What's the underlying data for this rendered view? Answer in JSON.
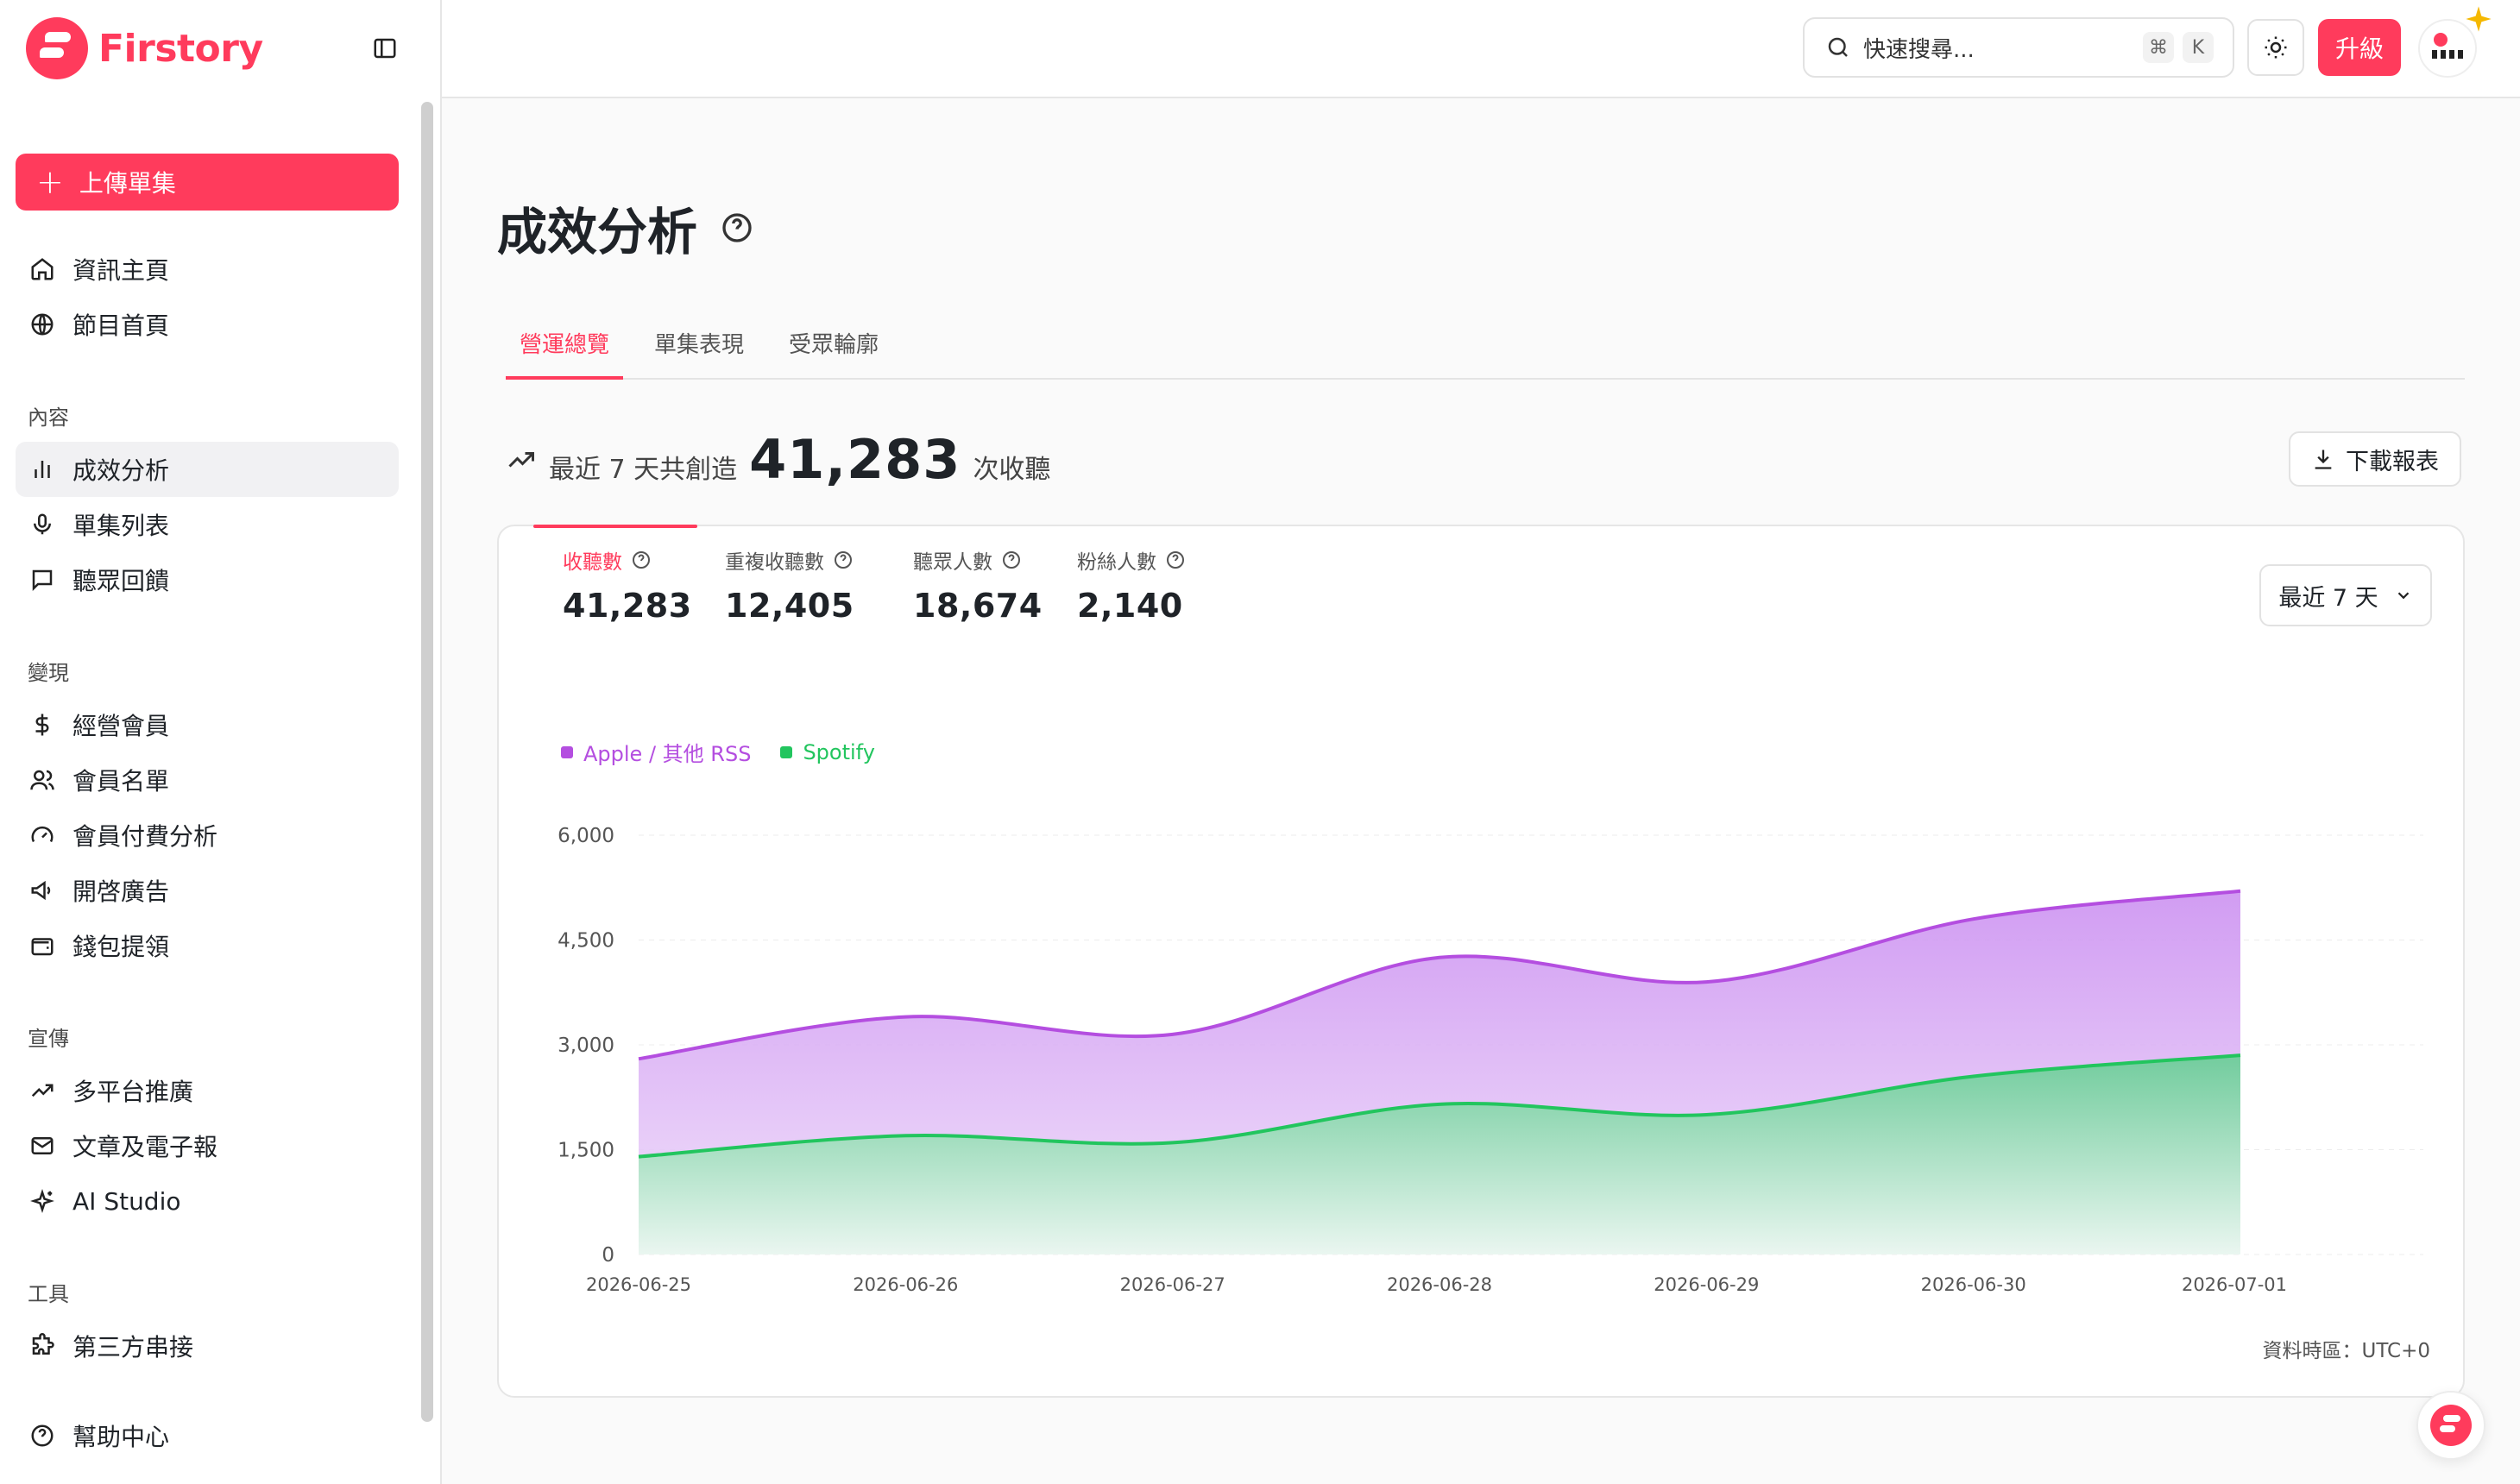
{
  "brand": {
    "name": "Firstory",
    "color": "#ff3b5c"
  },
  "sidebar": {
    "upload_label": "上傳單集",
    "top_items": [
      {
        "label": "資訊主頁",
        "icon": "home-icon"
      },
      {
        "label": "節目首頁",
        "icon": "globe-icon"
      }
    ],
    "sections": [
      {
        "label": "內容",
        "items": [
          {
            "label": "成效分析",
            "icon": "bar-chart-icon",
            "active": true
          },
          {
            "label": "單集列表",
            "icon": "microphone-icon"
          },
          {
            "label": "聽眾回饋",
            "icon": "message-icon"
          }
        ]
      },
      {
        "label": "變現",
        "items": [
          {
            "label": "經營會員",
            "icon": "dollar-icon"
          },
          {
            "label": "會員名單",
            "icon": "users-icon"
          },
          {
            "label": "會員付費分析",
            "icon": "gauge-icon"
          },
          {
            "label": "開啓廣告",
            "icon": "megaphone-icon"
          },
          {
            "label": "錢包提領",
            "icon": "wallet-icon"
          }
        ]
      },
      {
        "label": "宣傳",
        "items": [
          {
            "label": "多平台推廣",
            "icon": "trending-up-icon"
          },
          {
            "label": "文章及電子報",
            "icon": "mail-icon"
          },
          {
            "label": "AI Studio",
            "icon": "sparkles-icon"
          }
        ]
      },
      {
        "label": "工具",
        "items": [
          {
            "label": "第三方串接",
            "icon": "puzzle-icon"
          }
        ]
      }
    ],
    "help_label": "幫助中心"
  },
  "header": {
    "search_placeholder": "快速搜尋...",
    "shortcut_keys": [
      "⌘",
      "K"
    ],
    "upgrade_label": "升級"
  },
  "main": {
    "title": "成效分析",
    "tabs": [
      {
        "label": "營運總覽",
        "active": true
      },
      {
        "label": "單集表現",
        "active": false
      },
      {
        "label": "受眾輪廓",
        "active": false
      }
    ],
    "summary": {
      "prefix": "最近 7 天共創造",
      "value": "41,283",
      "suffix": "次收聽"
    },
    "download_label": "下載報表",
    "metrics": [
      {
        "label": "收聽數",
        "value": "41,283",
        "active": true
      },
      {
        "label": "重複收聽數",
        "value": "12,405",
        "active": false
      },
      {
        "label": "聽眾人數",
        "value": "18,674",
        "active": false
      },
      {
        "label": "粉絲人數",
        "value": "2,140",
        "active": false
      }
    ],
    "range_label": "最近 7 天",
    "timezone": "資料時區：UTC+0"
  },
  "chart_data": {
    "type": "area",
    "stacked": true,
    "x": [
      "2026-06-25",
      "2026-06-26",
      "2026-06-27",
      "2026-06-28",
      "2026-06-29",
      "2026-06-30",
      "2026-07-01"
    ],
    "series": [
      {
        "name": "Spotify",
        "color": "#22c55e",
        "values": [
          1400,
          1700,
          1600,
          2150,
          2000,
          2550,
          2850
        ]
      },
      {
        "name": "Apple / 其他 RSS",
        "color": "#b44ee0",
        "values": [
          1400,
          1700,
          1550,
          2100,
          1900,
          2250,
          2350
        ]
      }
    ],
    "yticks": [
      "0",
      "1,500",
      "3,000",
      "4,500",
      "6,000"
    ],
    "ylim": [
      0,
      6000
    ],
    "grid": true,
    "legend_position": "top-left"
  }
}
